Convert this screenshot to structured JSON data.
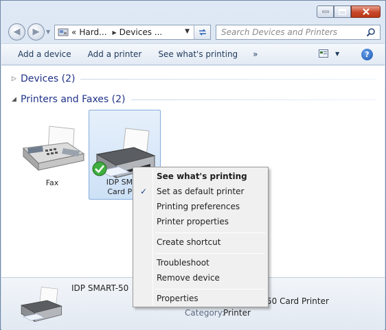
{
  "window": {
    "buttons": {
      "minimize": "minimize-icon",
      "maximize": "maximize-icon",
      "close": "close-icon"
    }
  },
  "nav": {
    "address": {
      "crumb1": "Hard...",
      "crumb2": "Devices ...",
      "prefix": "«"
    },
    "search_placeholder": "Search Devices and Printers"
  },
  "toolbar": {
    "items": [
      "Add a device",
      "Add a printer",
      "See what's printing"
    ],
    "more": "»",
    "help": "?"
  },
  "groups": {
    "devices": "Devices (2)",
    "printers": "Printers and Faxes (2)"
  },
  "devices": {
    "fax": {
      "label": "Fax"
    },
    "printer": {
      "line1": "IDP SMAR",
      "line2": "Card Prin"
    }
  },
  "details": {
    "name": "IDP SMART-50",
    "model": "50 Card Printer",
    "category_label": "Category:",
    "category_value": "Printer"
  },
  "context_menu": {
    "items": [
      {
        "label": "See what's printing",
        "bold": true
      },
      {
        "label": "Set as default printer",
        "checked": true
      },
      {
        "label": "Printing preferences"
      },
      {
        "label": "Printer properties"
      },
      {
        "label": "Create shortcut"
      },
      {
        "label": "Troubleshoot"
      },
      {
        "label": "Remove device"
      },
      {
        "label": "Properties"
      }
    ],
    "check_mark": "✓"
  },
  "colors": {
    "accent": "#1e3287",
    "selection": "#cde1f6",
    "close": "#c7462a"
  }
}
